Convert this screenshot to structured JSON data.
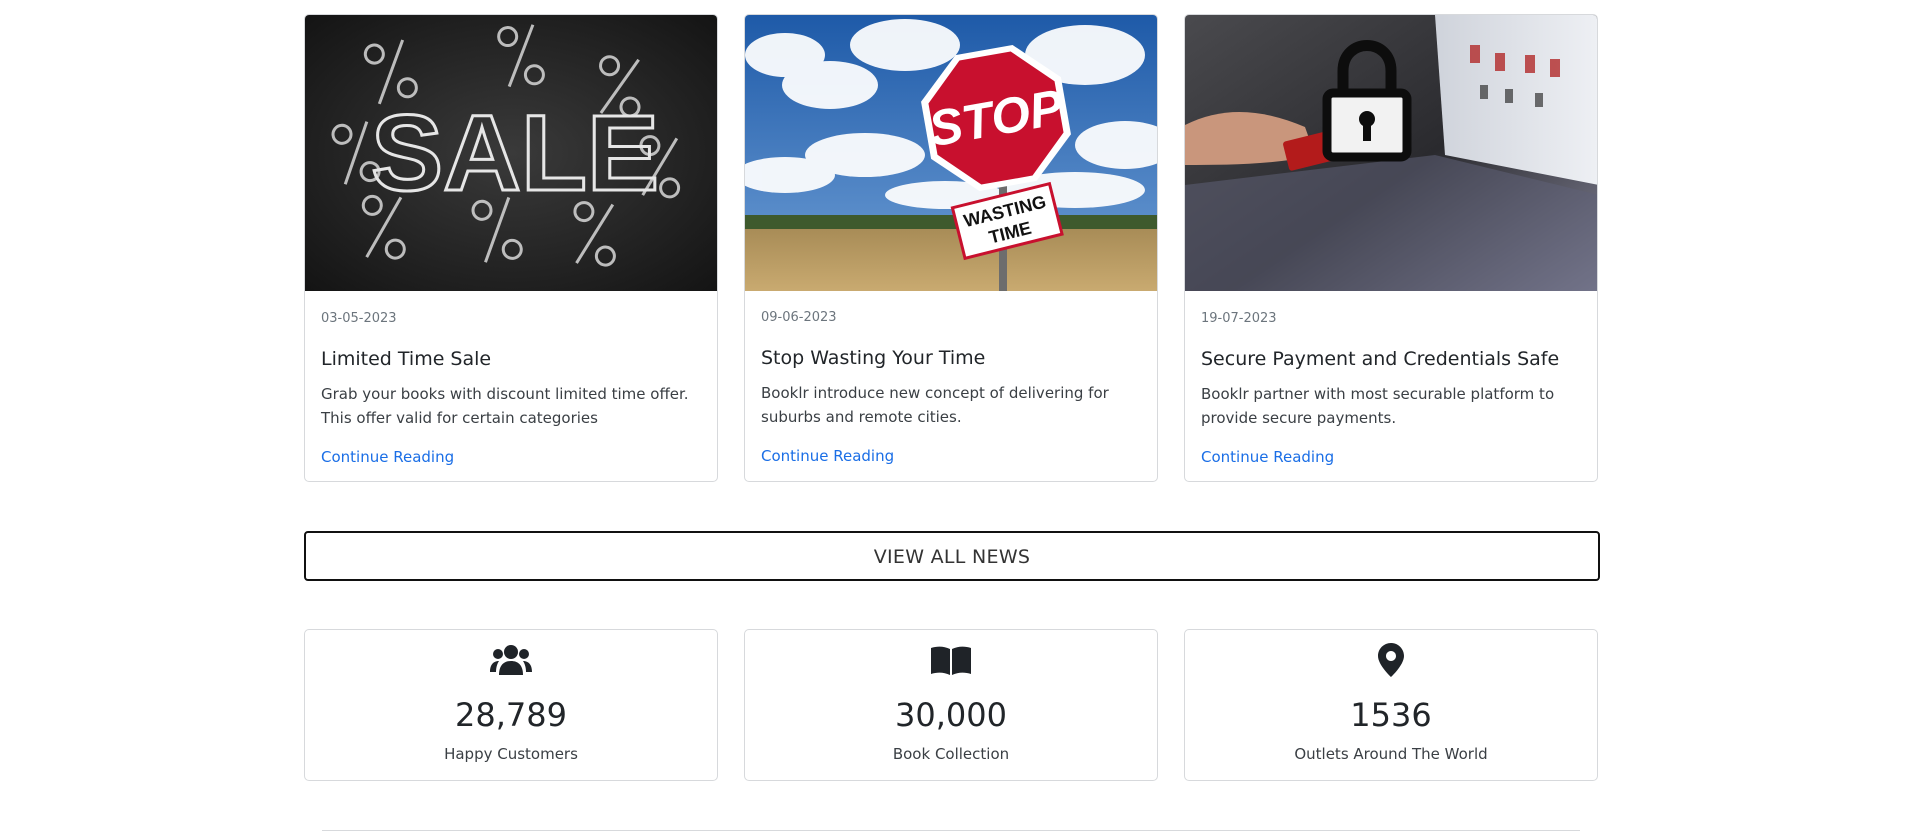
{
  "news": {
    "cards": [
      {
        "image": "sale-chalkboard-image",
        "date": "03-05-2023",
        "title": "Limited Time Sale",
        "text": "Grab your books with discount limited time offer. This offer valid for certain categories",
        "link": "Continue Reading"
      },
      {
        "image": "stop-wasting-time-sign-image",
        "date": "09-06-2023",
        "title": "Stop Wasting Your Time",
        "text": "Booklr introduce new concept of delivering for suburbs and remote cities.",
        "link": "Continue Reading"
      },
      {
        "image": "secure-payment-padlock-image",
        "date": "19-07-2023",
        "title": "Secure Payment and Credentials Safe",
        "text": "Booklr partner with most securable platform to provide secure payments.",
        "link": "Continue Reading"
      }
    ],
    "view_all_label": "VIEW ALL NEWS"
  },
  "image_text": {
    "sale": "SALE",
    "stop": "STOP",
    "wasting": "WASTING",
    "time": "TIME"
  },
  "stats": [
    {
      "icon": "users-icon",
      "value": "28,789",
      "label": "Happy Customers"
    },
    {
      "icon": "book-open-icon",
      "value": "30,000",
      "label": "Book Collection"
    },
    {
      "icon": "map-pin-icon",
      "value": "1536",
      "label": "Outlets Around The World"
    }
  ],
  "colors": {
    "link": "#1a6ee6",
    "border": "#d7d9dc",
    "text": "#212529",
    "muted": "#6c757d"
  }
}
